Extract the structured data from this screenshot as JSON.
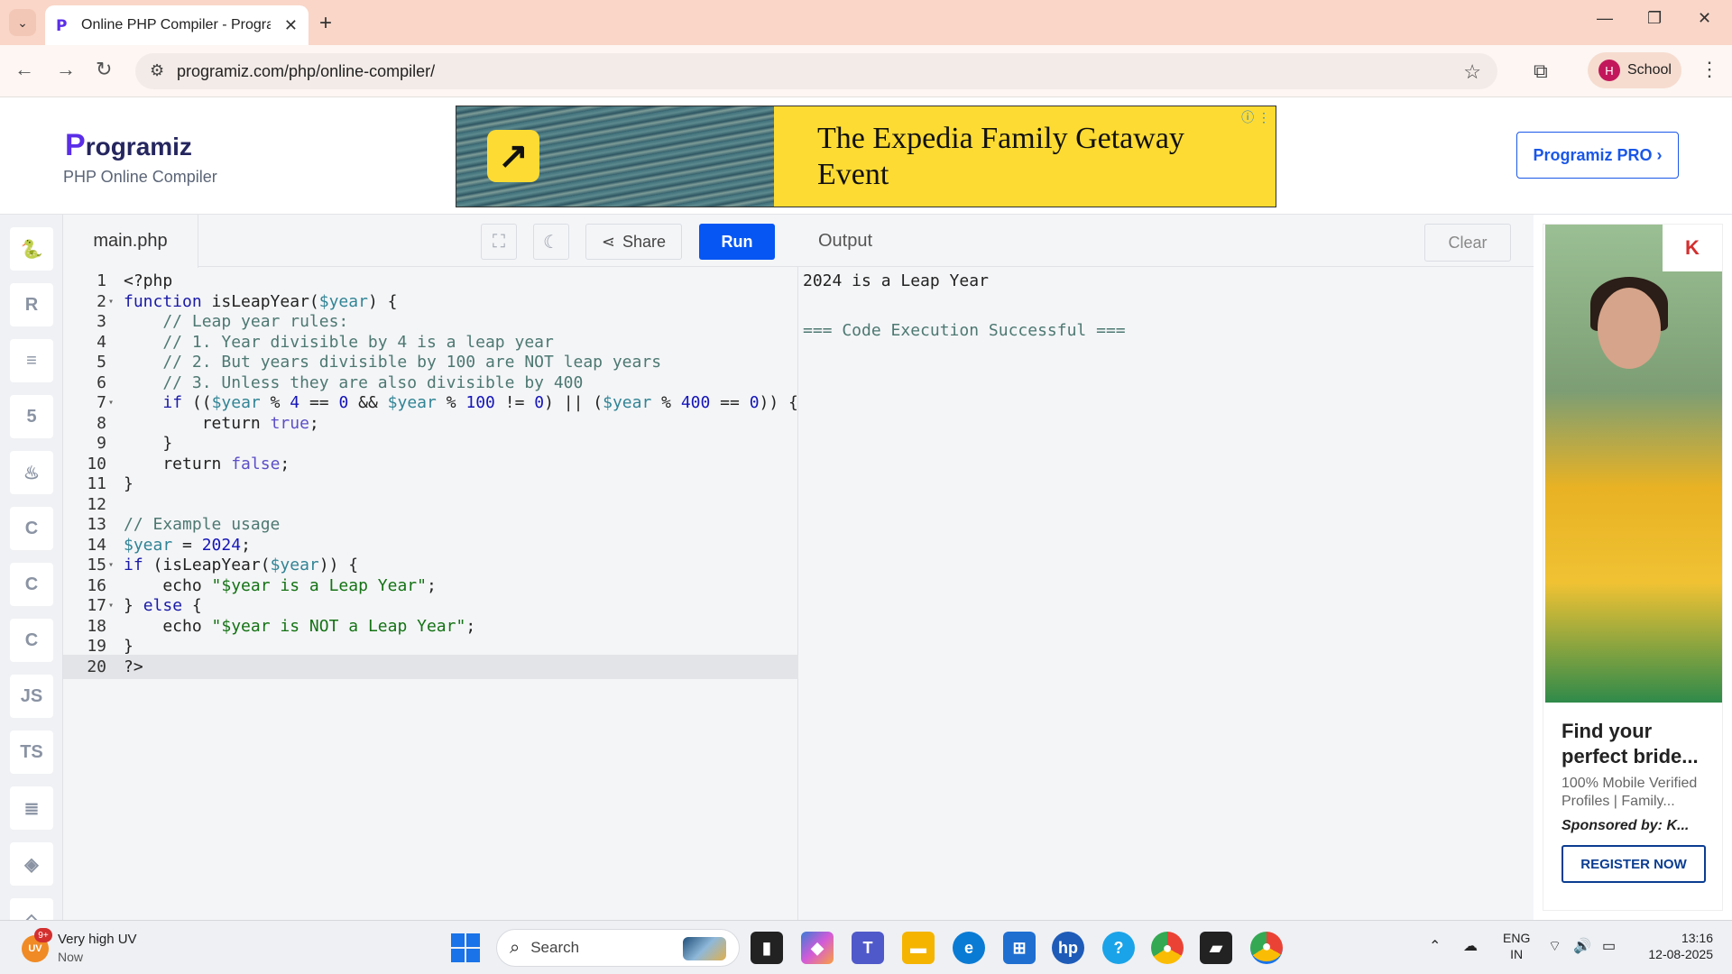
{
  "browser": {
    "tab_title": "Online PHP Compiler - Programiz",
    "url": "programiz.com/php/online-compiler/",
    "profile_initial": "H",
    "profile_label": "School"
  },
  "header": {
    "logo_text": "rogramiz",
    "logo_initial": "P",
    "subtitle": "PHP Online Compiler",
    "pro_button": "Programiz PRO ›",
    "ad_text": "The Expedia Family Getaway Event"
  },
  "sidebar": {
    "items": [
      {
        "name": "python",
        "glyph": "🐍"
      },
      {
        "name": "r",
        "glyph": "R"
      },
      {
        "name": "sql",
        "glyph": "≡"
      },
      {
        "name": "html",
        "glyph": "5"
      },
      {
        "name": "java",
        "glyph": "♨"
      },
      {
        "name": "c",
        "glyph": "C"
      },
      {
        "name": "cpp",
        "glyph": "C"
      },
      {
        "name": "csharp",
        "glyph": "C"
      },
      {
        "name": "js",
        "glyph": "JS"
      },
      {
        "name": "ts",
        "glyph": "TS"
      },
      {
        "name": "go",
        "glyph": "≣"
      },
      {
        "name": "swift",
        "glyph": "◈"
      },
      {
        "name": "more",
        "glyph": "◇"
      }
    ]
  },
  "editor": {
    "filename": "main.php",
    "share_label": "Share",
    "run_label": "Run",
    "lines": [
      "<?php",
      "function isLeapYear($year) {",
      "    // Leap year rules:",
      "    // 1. Year divisible by 4 is a leap year",
      "    // 2. But years divisible by 100 are NOT leap years",
      "    // 3. Unless they are also divisible by 400",
      "    if (($year % 4 == 0 && $year % 100 != 0) || ($year % 400 == 0)) {",
      "        return true;",
      "    }",
      "    return false;",
      "}",
      "",
      "// Example usage",
      "$year = 2024;",
      "if (isLeapYear($year)) {",
      "    echo \"$year is a Leap Year\";",
      "} else {",
      "    echo \"$year is NOT a Leap Year\";",
      "}",
      "?>"
    ]
  },
  "output": {
    "title": "Output",
    "clear_label": "Clear",
    "result_line": "2024 is a Leap Year",
    "status_line": "=== Code Execution Successful ==="
  },
  "right_ad": {
    "brand": "K",
    "headline": "Find your perfect bride...",
    "description": "100% Mobile Verified Profiles | Family...",
    "sponsor": "Sponsored by: K...",
    "cta": "REGISTER NOW"
  },
  "taskbar": {
    "weather_title": "Very high UV",
    "weather_sub": "Now",
    "weather_badge": "9+",
    "weather_abbr": "UV",
    "search_label": "Search",
    "lang_top": "ENG",
    "lang_bottom": "IN",
    "time": "13:16",
    "date": "12-08-2025"
  },
  "colors": {
    "run_button": "#0556f3",
    "accent": "#1a57e8",
    "tabbar": "#f9d6c8"
  }
}
